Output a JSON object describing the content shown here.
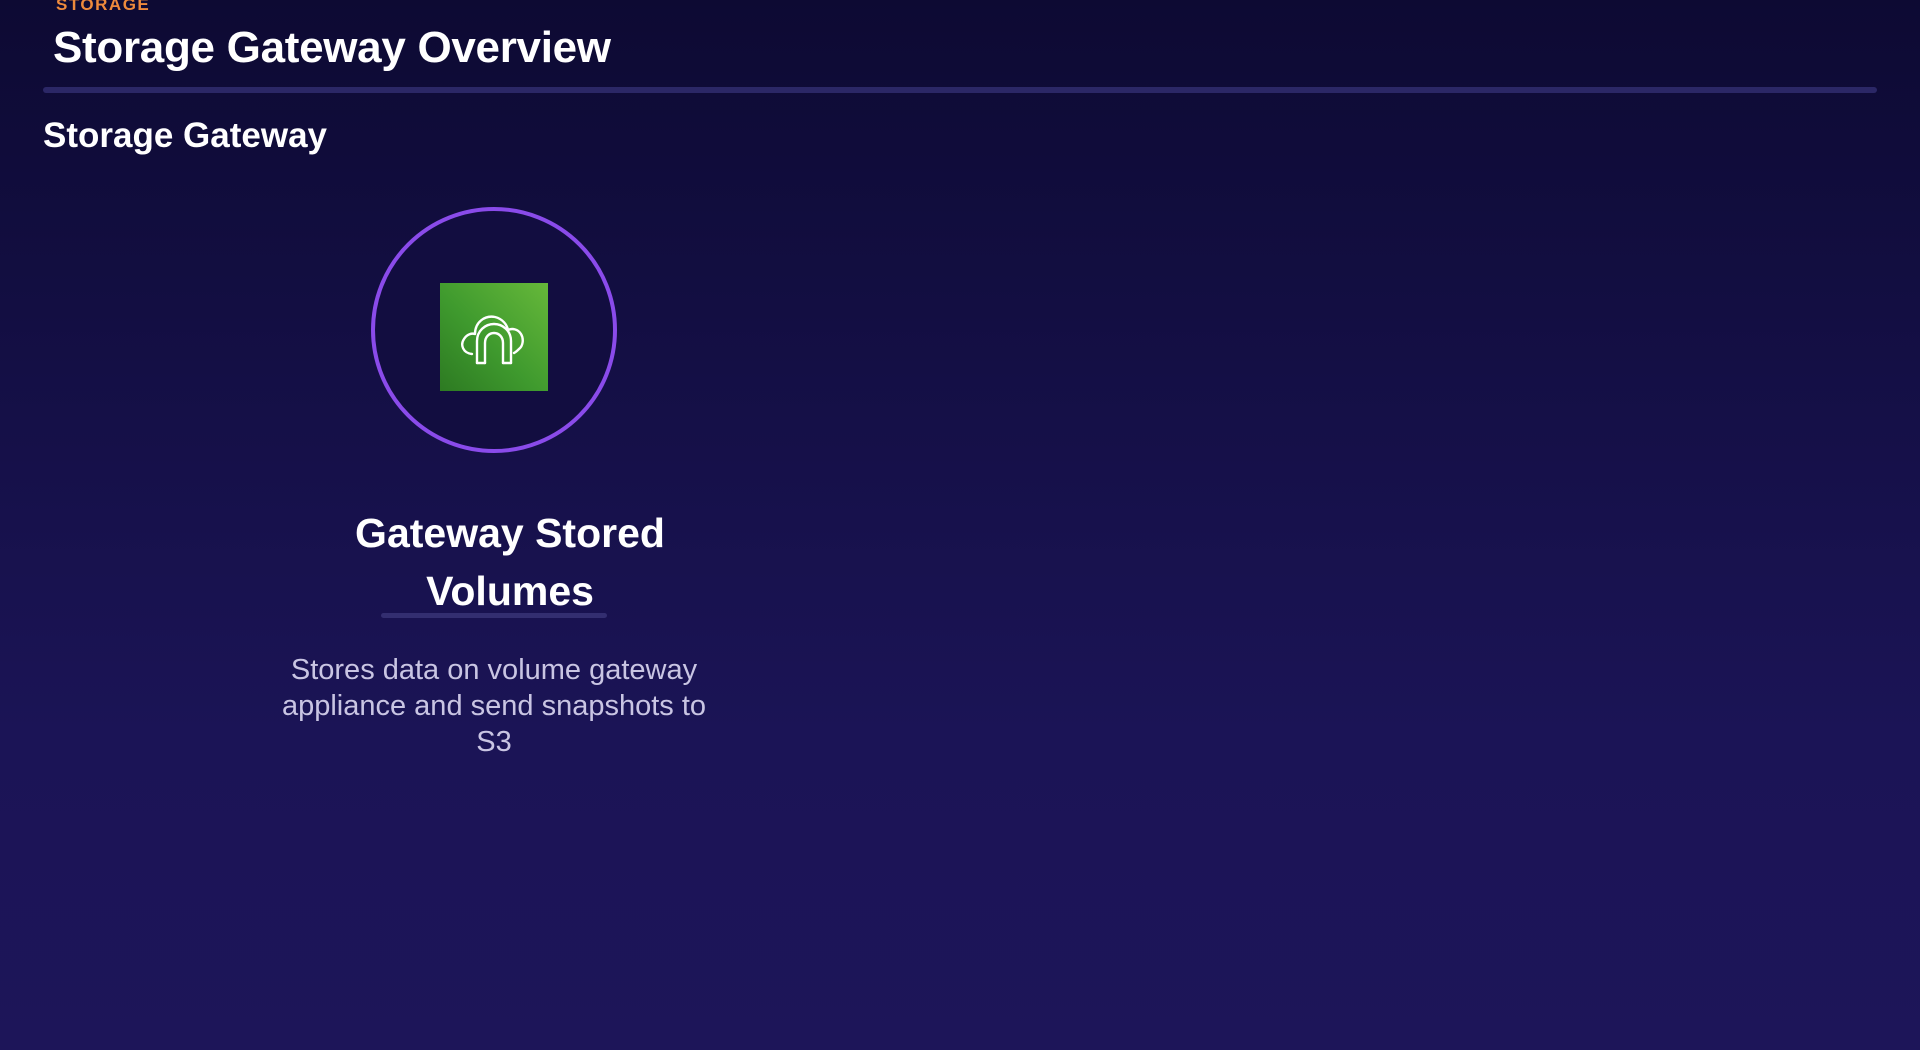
{
  "header": {
    "eyebrow": "STORAGE",
    "title": "Storage Gateway Overview"
  },
  "section": {
    "title": "Storage Gateway"
  },
  "card": {
    "icon": "storage-gateway-icon",
    "title": "Gateway Stored Volumes",
    "description": "Stores data on volume gateway appliance and send snapshots to S3"
  },
  "colors": {
    "accent_orange": "#ee8a3c",
    "ring_purple": "#8a4bea",
    "tile_green": "#3f9a2e",
    "background_top": "#0d0a33",
    "background_bottom": "#1d1559"
  }
}
